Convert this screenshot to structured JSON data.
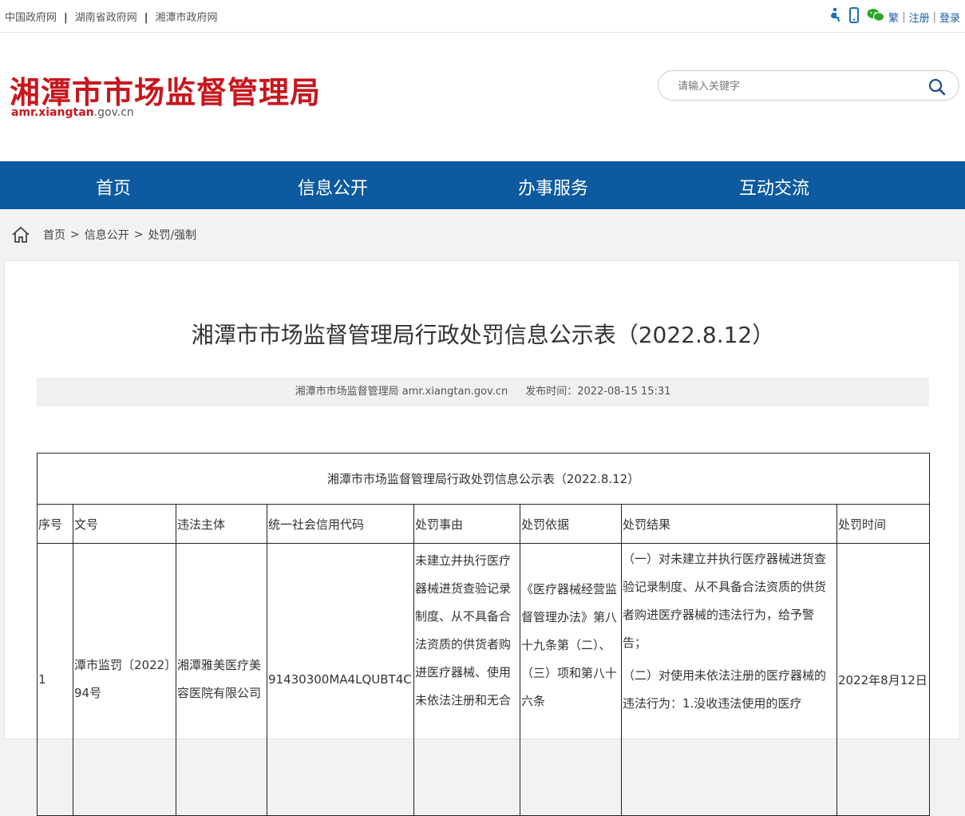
{
  "topbar": {
    "links": [
      "中国政府网",
      "湖南省政府网",
      "湘潭市政府网"
    ],
    "icons": [
      "accessibility-icon",
      "mobile-icon",
      "wechat-icon"
    ],
    "right_links": [
      "繁",
      "注册",
      "登录"
    ]
  },
  "header": {
    "title": "湘潭市市场监督管理局",
    "domain_bold": "amr.xiangtan",
    "domain_rest": ".gov.cn",
    "search_placeholder": "请输入关键字"
  },
  "nav": [
    "首页",
    "信息公开",
    "办事服务",
    "互动交流"
  ],
  "breadcrumb": [
    "首页",
    "信息公开",
    "处罚/强制"
  ],
  "article": {
    "title": "湘潭市市场监督管理局行政处罚信息公示表（2022.8.12）",
    "source": "湘潭市市场监督管理局 amr.xiangtan.gov.cn",
    "publish_time": "发布时间：2022-08-15 15:31"
  },
  "table": {
    "caption": "湘潭市市场监督管理局行政处罚信息公示表（2022.8.12）",
    "headers": [
      "序号",
      "文号",
      "违法主体",
      "统一社会信用代码",
      "处罚事由",
      "处罚依据",
      "处罚结果",
      "处罚时间"
    ],
    "row": {
      "seq": "1",
      "doc_no": "潭市监罚〔2022〕94号",
      "subject": "湘潭雅美医疗美容医院有限公司",
      "credit_code": "91430300MA4LQUBT4C",
      "reason": "未建立并执行医疗器械进货查验记录制度、从不具备合法资质的供货者购进医疗器械、使用未依法注册和无合",
      "basis": "《医疗器械经营监督管理办法》第八十九条第（二）、（三）项和第八十六条",
      "result_1": "（一）对未建立并执行医疗器械进货查验记录制度、从不具备合法资质的供货者购进医疗器械的违法行为，给予警告；",
      "result_2": "（二）对使用未依法注册的医疗器械的违法行为：1.没收违法使用的医疗",
      "date": "2022年8月12日"
    }
  },
  "colors": {
    "brand_red": "#c8161d",
    "nav_blue": "#0d5aa0"
  }
}
